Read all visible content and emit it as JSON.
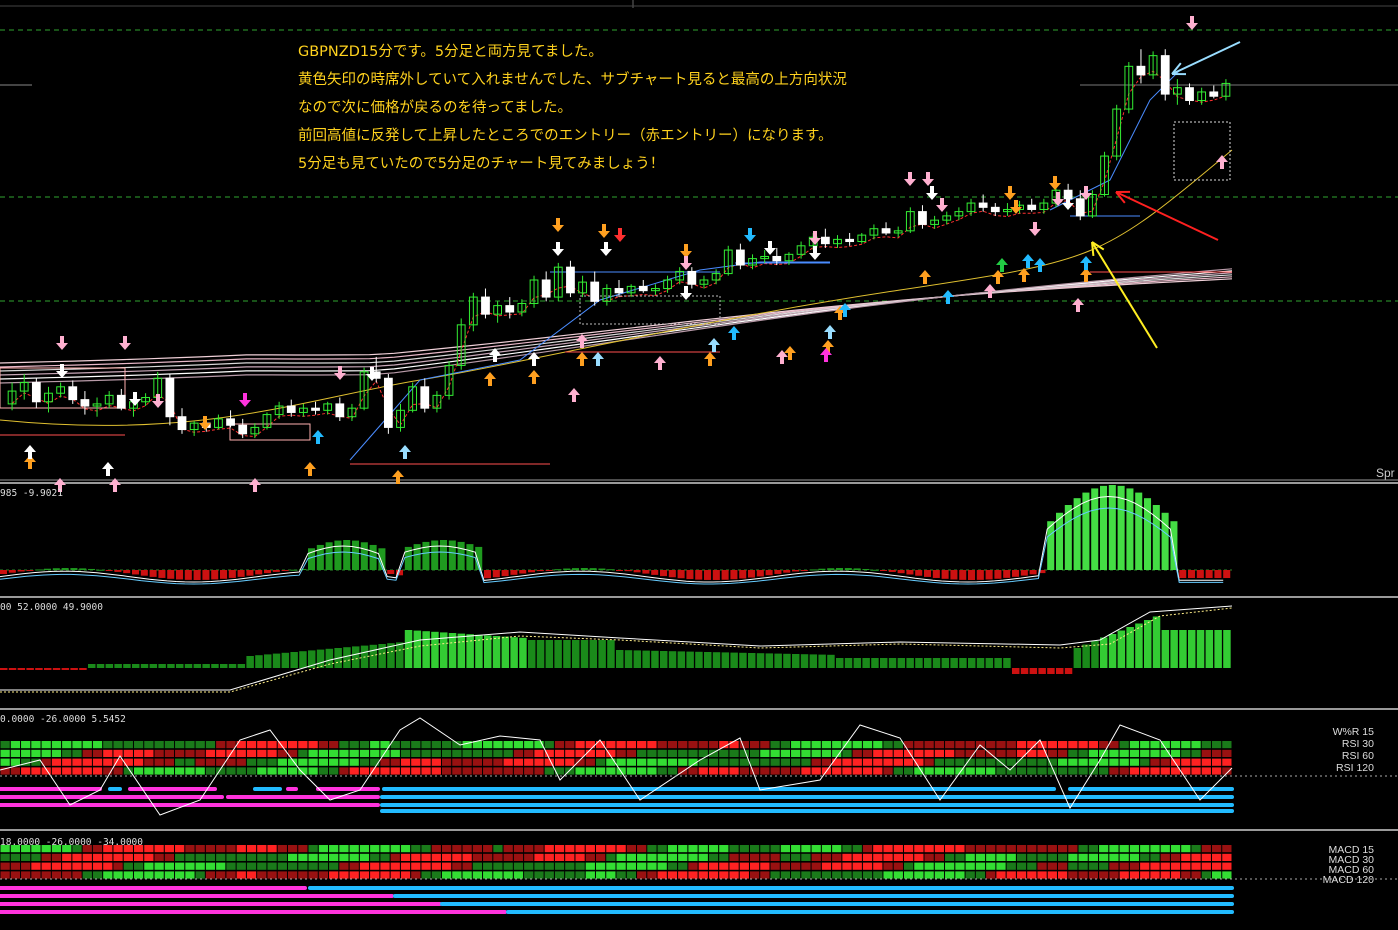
{
  "annotation": {
    "lines": [
      "GBPNZD15分です。5分足と両方見てました。",
      "黄色矢印の時席外していて入れませんでした、サブチャート見ると最高の上方向状況",
      "なので次に価格が戻るのを待ってました。",
      "前回高値に反発して上昇したところでのエントリー（赤エントリー）になります。",
      "5分足も見ていたので5分足のチャート見てみましょう！"
    ],
    "color": "#ffd21e"
  },
  "main_panel": {
    "label": "Spr"
  },
  "sub_panels": [
    {
      "id": "osc1",
      "label": "985 -9.9021"
    },
    {
      "id": "osc2",
      "label": "00 52.0000 49.9000"
    },
    {
      "id": "heat1",
      "label": "0.0000 -26.0000 5.5452",
      "legend": [
        "W%R 15",
        "RSI 30",
        "RSI 60",
        "RSI 120"
      ]
    },
    {
      "id": "heat2",
      "label": "18.0000 -26.0000 -34.0000",
      "legend": [
        "MACD 15",
        "MACD 30",
        "MACD 60",
        "MACD 120"
      ]
    }
  ],
  "colors": {
    "bull": "#33ee33",
    "bear": "#ffffff",
    "up_bar": "#2ecc2e",
    "down_bar": "#cc1111",
    "magenta": "#ff33dd",
    "cyan": "#22bbff",
    "arrow_yellow": "#ffee22",
    "arrow_red": "#ff2020",
    "arrow_lightblue": "#99ddff"
  },
  "chart_data": {
    "type": "candlestick",
    "symbol": "GBPNZD",
    "timeframe": "15",
    "candles": [
      [
        2.3,
        2.4,
        2.27,
        2.36
      ],
      [
        2.36,
        2.44,
        2.32,
        2.4
      ],
      [
        2.4,
        2.42,
        2.28,
        2.31
      ],
      [
        2.31,
        2.38,
        2.26,
        2.35
      ],
      [
        2.35,
        2.4,
        2.33,
        2.38
      ],
      [
        2.38,
        2.41,
        2.3,
        2.32
      ],
      [
        2.32,
        2.36,
        2.25,
        2.29
      ],
      [
        2.29,
        2.33,
        2.24,
        2.3
      ],
      [
        2.3,
        2.36,
        2.28,
        2.34
      ],
      [
        2.34,
        2.37,
        2.27,
        2.28
      ],
      [
        2.28,
        2.32,
        2.24,
        2.31
      ],
      [
        2.31,
        2.35,
        2.29,
        2.33
      ],
      [
        2.33,
        2.45,
        2.31,
        2.42
      ],
      [
        2.42,
        2.44,
        2.2,
        2.24
      ],
      [
        2.24,
        2.28,
        2.16,
        2.18
      ],
      [
        2.18,
        2.22,
        2.15,
        2.21
      ],
      [
        2.21,
        2.24,
        2.17,
        2.19
      ],
      [
        2.19,
        2.25,
        2.18,
        2.23
      ],
      [
        2.23,
        2.27,
        2.19,
        2.2
      ],
      [
        2.2,
        2.23,
        2.14,
        2.16
      ],
      [
        2.16,
        2.21,
        2.14,
        2.19
      ],
      [
        2.19,
        2.26,
        2.18,
        2.25
      ],
      [
        2.25,
        2.31,
        2.23,
        2.29
      ],
      [
        2.29,
        2.32,
        2.24,
        2.26
      ],
      [
        2.26,
        2.3,
        2.24,
        2.28
      ],
      [
        2.28,
        2.31,
        2.25,
        2.27
      ],
      [
        2.27,
        2.31,
        2.25,
        2.3
      ],
      [
        2.3,
        2.33,
        2.22,
        2.24
      ],
      [
        2.24,
        2.3,
        2.22,
        2.28
      ],
      [
        2.28,
        2.47,
        2.27,
        2.45
      ],
      [
        2.45,
        2.52,
        2.4,
        2.42
      ],
      [
        2.42,
        2.44,
        2.16,
        2.19
      ],
      [
        2.19,
        2.3,
        2.17,
        2.27
      ],
      [
        2.27,
        2.4,
        2.26,
        2.38
      ],
      [
        2.38,
        2.42,
        2.26,
        2.28
      ],
      [
        2.28,
        2.36,
        2.26,
        2.34
      ],
      [
        2.34,
        2.5,
        2.32,
        2.48
      ],
      [
        2.48,
        2.7,
        2.46,
        2.67
      ],
      [
        2.67,
        2.82,
        2.64,
        2.8
      ],
      [
        2.8,
        2.84,
        2.7,
        2.72
      ],
      [
        2.72,
        2.78,
        2.68,
        2.76
      ],
      [
        2.76,
        2.8,
        2.7,
        2.73
      ],
      [
        2.73,
        2.79,
        2.71,
        2.77
      ],
      [
        2.77,
        2.9,
        2.75,
        2.88
      ],
      [
        2.88,
        2.92,
        2.78,
        2.8
      ],
      [
        2.8,
        2.96,
        2.78,
        2.94
      ],
      [
        2.94,
        2.97,
        2.8,
        2.82
      ],
      [
        2.82,
        2.9,
        2.8,
        2.87
      ],
      [
        2.87,
        2.92,
        2.76,
        2.78
      ],
      [
        2.78,
        2.86,
        2.76,
        2.84
      ],
      [
        2.84,
        2.88,
        2.8,
        2.82
      ],
      [
        2.82,
        2.86,
        2.8,
        2.85
      ],
      [
        2.85,
        2.88,
        2.82,
        2.83
      ],
      [
        2.83,
        2.86,
        2.81,
        2.84
      ],
      [
        2.84,
        2.9,
        2.82,
        2.88
      ],
      [
        2.88,
        2.94,
        2.86,
        2.92
      ],
      [
        2.92,
        2.94,
        2.84,
        2.86
      ],
      [
        2.86,
        2.9,
        2.84,
        2.88
      ],
      [
        2.88,
        2.93,
        2.86,
        2.91
      ],
      [
        2.91,
        3.04,
        2.9,
        3.02
      ],
      [
        3.02,
        3.05,
        2.93,
        2.95
      ],
      [
        2.95,
        3.0,
        2.93,
        2.98
      ],
      [
        2.98,
        3.02,
        2.96,
        2.99
      ],
      [
        2.99,
        3.03,
        2.95,
        2.97
      ],
      [
        2.97,
        3.01,
        2.95,
        3.0
      ],
      [
        3.0,
        3.06,
        2.98,
        3.04
      ],
      [
        3.04,
        3.1,
        3.02,
        3.08
      ],
      [
        3.08,
        3.12,
        3.03,
        3.05
      ],
      [
        3.05,
        3.09,
        3.03,
        3.07
      ],
      [
        3.07,
        3.1,
        3.04,
        3.06
      ],
      [
        3.06,
        3.1,
        3.05,
        3.09
      ],
      [
        3.09,
        3.14,
        3.07,
        3.12
      ],
      [
        3.12,
        3.15,
        3.09,
        3.1
      ],
      [
        3.1,
        3.13,
        3.08,
        3.11
      ],
      [
        3.11,
        3.22,
        3.1,
        3.2
      ],
      [
        3.2,
        3.23,
        3.12,
        3.14
      ],
      [
        3.14,
        3.18,
        3.12,
        3.16
      ],
      [
        3.16,
        3.2,
        3.14,
        3.18
      ],
      [
        3.18,
        3.22,
        3.16,
        3.2
      ],
      [
        3.2,
        3.26,
        3.18,
        3.24
      ],
      [
        3.24,
        3.28,
        3.2,
        3.22
      ],
      [
        3.22,
        3.24,
        3.18,
        3.2
      ],
      [
        3.2,
        3.24,
        3.18,
        3.21
      ],
      [
        3.21,
        3.25,
        3.19,
        3.23
      ],
      [
        3.23,
        3.26,
        3.2,
        3.21
      ],
      [
        3.21,
        3.26,
        3.19,
        3.24
      ],
      [
        3.24,
        3.32,
        3.22,
        3.3
      ],
      [
        3.3,
        3.33,
        3.24,
        3.26
      ],
      [
        3.26,
        3.3,
        3.16,
        3.18
      ],
      [
        3.18,
        3.3,
        3.17,
        3.28
      ],
      [
        3.28,
        3.48,
        3.27,
        3.46
      ],
      [
        3.46,
        3.7,
        3.44,
        3.68
      ],
      [
        3.68,
        3.9,
        3.66,
        3.88
      ],
      [
        3.88,
        3.96,
        3.8,
        3.84
      ],
      [
        3.84,
        3.95,
        3.82,
        3.93
      ],
      [
        3.93,
        3.96,
        3.72,
        3.75
      ],
      [
        3.75,
        3.82,
        3.7,
        3.78
      ],
      [
        3.78,
        3.8,
        3.7,
        3.72
      ],
      [
        3.72,
        3.78,
        3.7,
        3.76
      ],
      [
        3.76,
        3.79,
        3.73,
        3.74
      ],
      [
        3.74,
        3.82,
        3.72,
        3.8
      ]
    ]
  }
}
